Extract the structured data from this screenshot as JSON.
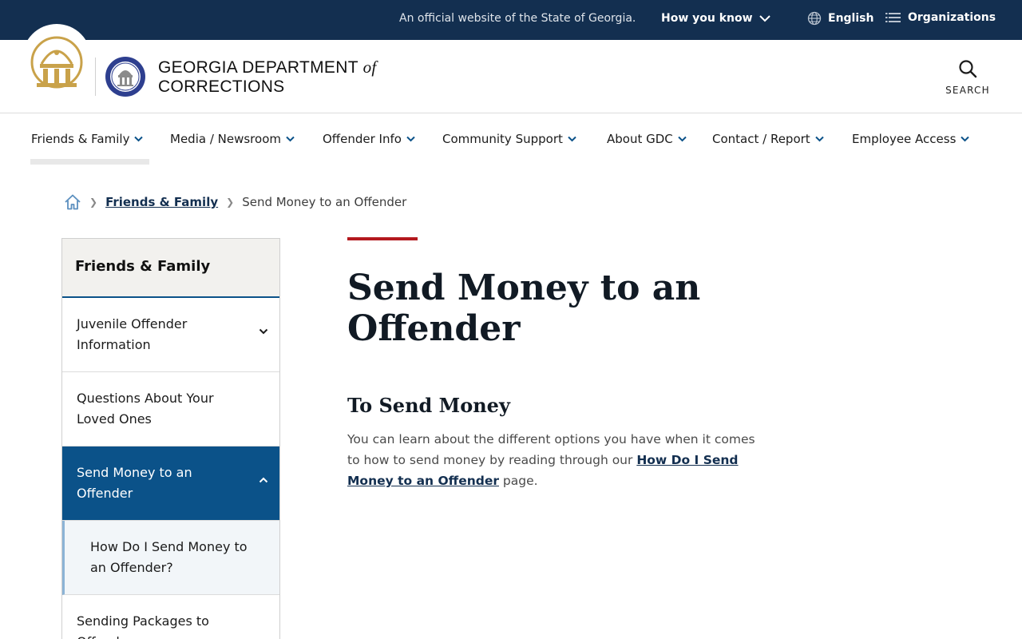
{
  "topbar": {
    "official_text": "An official website of the State of Georgia.",
    "how_you_know": "How you know",
    "language": "English",
    "organizations": "Organizations"
  },
  "header": {
    "title_line1": "GEORGIA DEPARTMENT",
    "title_of": "of",
    "title_line2": "CORRECTIONS",
    "search_label": "SEARCH"
  },
  "nav": {
    "items": [
      {
        "label": "Friends & Family"
      },
      {
        "label": "Media / Newsroom"
      },
      {
        "label": "Offender Info"
      },
      {
        "label": "Community Support"
      },
      {
        "label": "About GDC"
      },
      {
        "label": "Contact / Report"
      },
      {
        "label": "Employee Access"
      }
    ]
  },
  "breadcrumb": {
    "parent": "Friends & Family",
    "current": "Send Money to an Offender"
  },
  "sidebar": {
    "heading": "Friends & Family",
    "items": [
      {
        "label": "Juvenile Offender Information"
      },
      {
        "label": "Questions About Your Loved Ones"
      },
      {
        "label": "Send Money to an Offender"
      },
      {
        "label": "How Do I Send Money to an Offender?"
      },
      {
        "label": "Sending Packages to Offenders"
      }
    ]
  },
  "main": {
    "title": "Send Money to an Offender",
    "section_title": "To Send Money",
    "para_before": "You can learn about the different options you have when it comes to how to send money by reading through our ",
    "para_link": "How Do I Send Money to an Offender",
    "para_after": " page."
  },
  "colors": {
    "topbar": "#132f50",
    "accent_blue": "#0b5289",
    "accent_red": "#b3191e",
    "seal_gold": "#c9a24a"
  }
}
